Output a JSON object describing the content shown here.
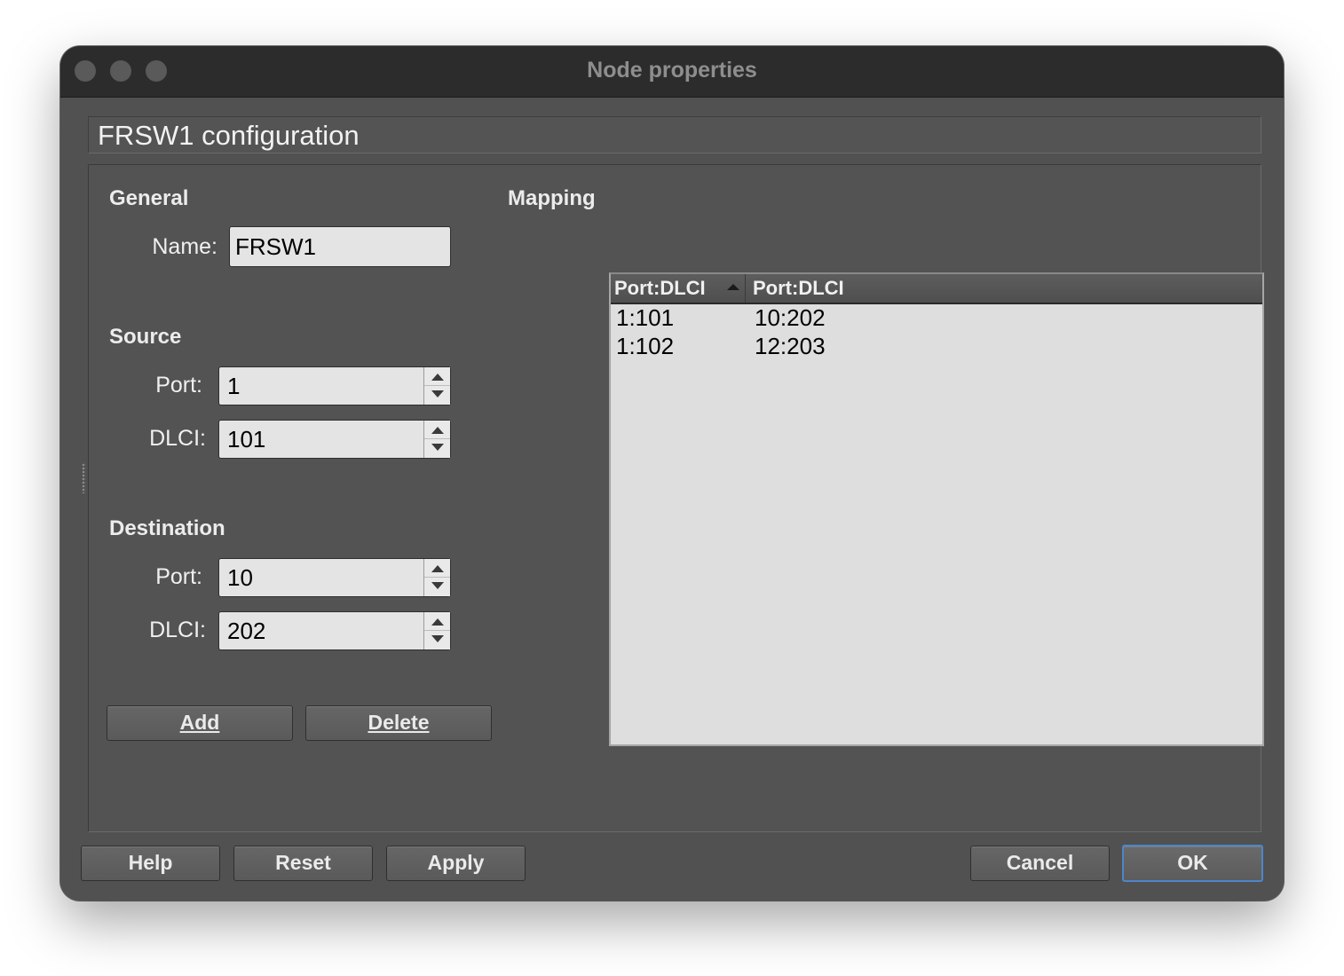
{
  "window": {
    "title": "Node properties"
  },
  "header": {
    "title": "FRSW1 configuration"
  },
  "general": {
    "section_label": "General",
    "name_label": "Name:",
    "name_value": "FRSW1"
  },
  "source": {
    "section_label": "Source",
    "port_label": "Port:",
    "port_value": "1",
    "dlci_label": "DLCI:",
    "dlci_value": "101"
  },
  "destination": {
    "section_label": "Destination",
    "port_label": "Port:",
    "port_value": "10",
    "dlci_label": "DLCI:",
    "dlci_value": "202"
  },
  "actions": {
    "add_label": "Add",
    "delete_label": "Delete"
  },
  "mapping": {
    "section_label": "Mapping",
    "columns": [
      "Port:DLCI",
      "Port:DLCI"
    ],
    "sort_column": 0,
    "sort_direction": "ascending",
    "rows": [
      [
        "1:101",
        "10:202"
      ],
      [
        "1:102",
        "12:203"
      ]
    ]
  },
  "footer": {
    "help_label": "Help",
    "reset_label": "Reset",
    "apply_label": "Apply",
    "cancel_label": "Cancel",
    "ok_label": "OK"
  },
  "colors": {
    "window_bg": "#515151",
    "titlebar_bg": "#2c2c2c",
    "default_button_border": "#4e86c9"
  }
}
